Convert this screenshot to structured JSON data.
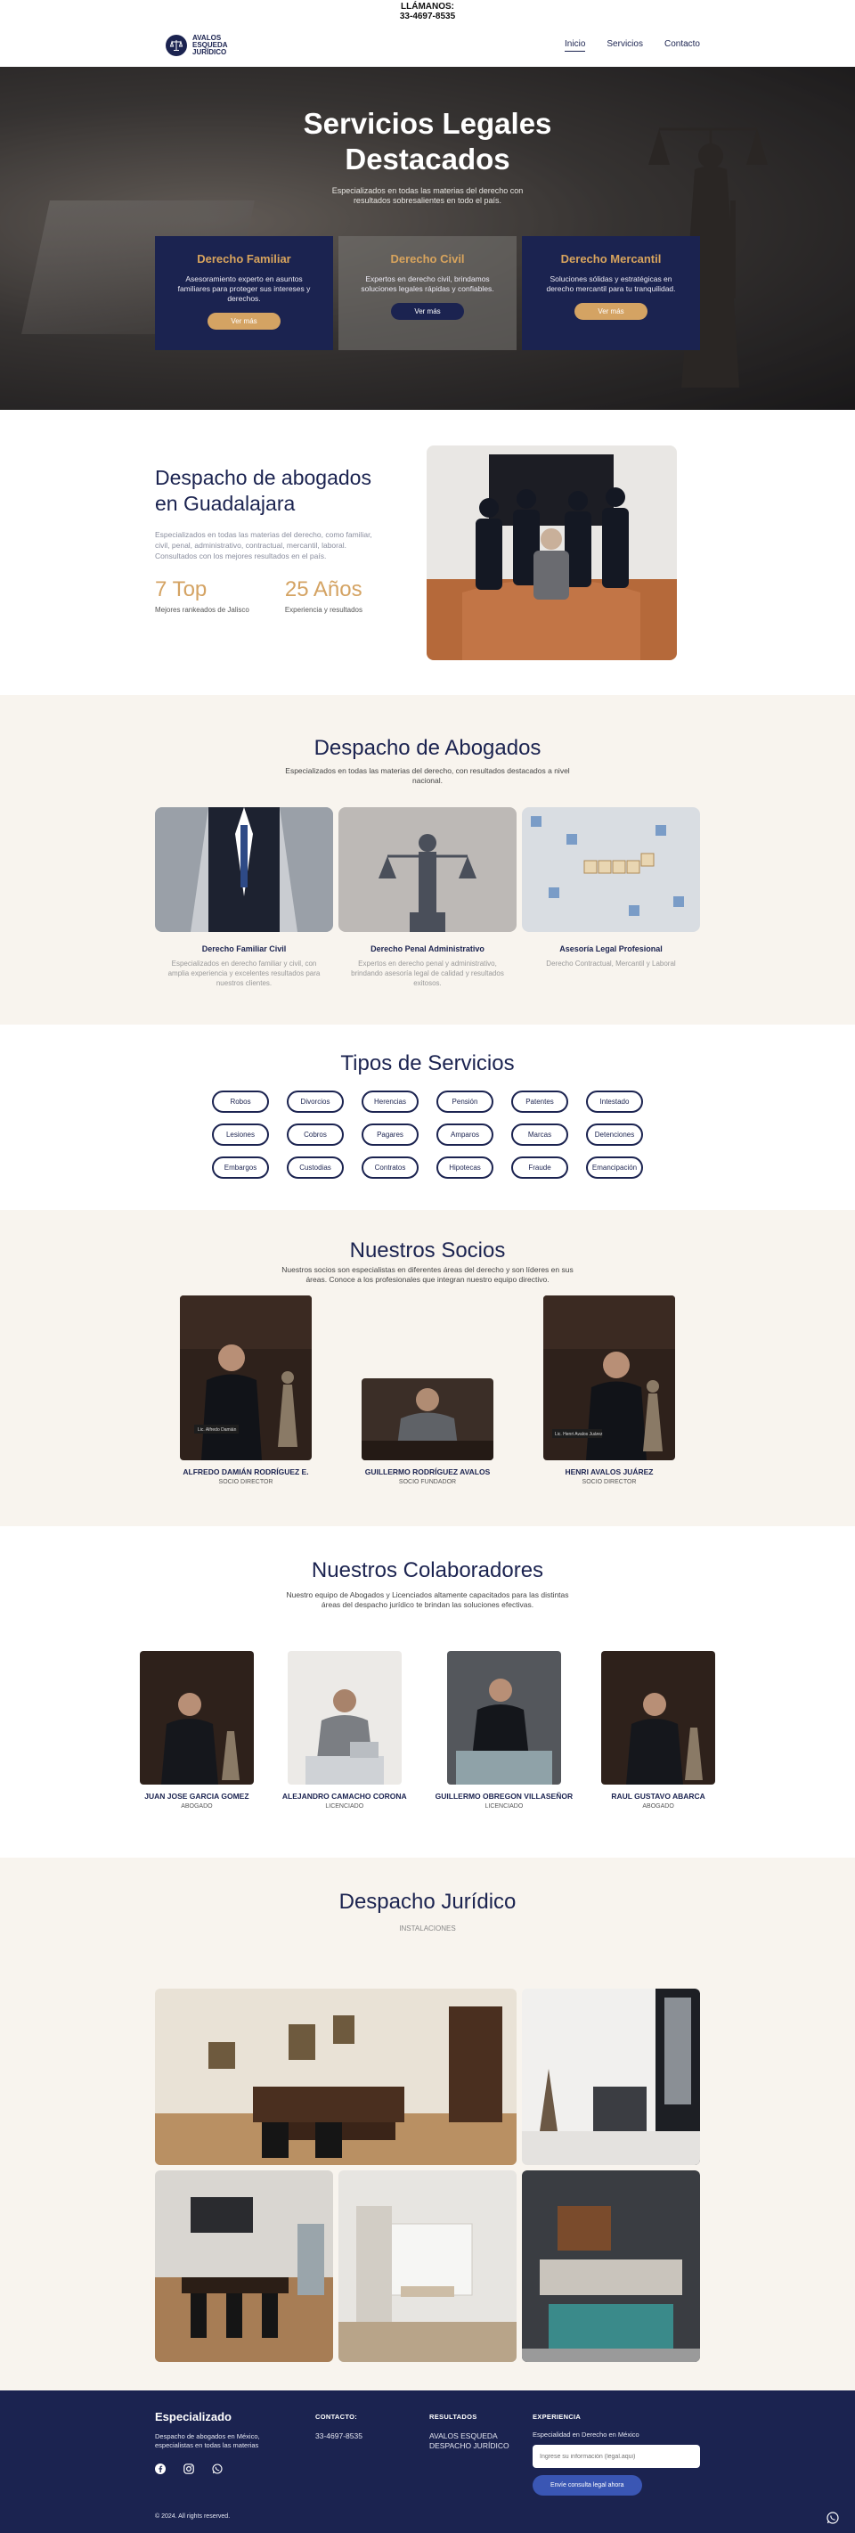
{
  "topbar": {
    "label": "LLÁMANOS:",
    "phone": "33-4697-8535"
  },
  "brand": {
    "line1": "AVALOS",
    "line2": "ESQUEDA",
    "line3": "JURÍDICO"
  },
  "nav": {
    "items": [
      "Inicio",
      "Servicios",
      "Contacto"
    ]
  },
  "hero": {
    "title": "Servicios Legales Destacados",
    "subtitle": "Especializados en todas las materias del derecho con resultados sobresalientes en todo el país.",
    "cards": [
      {
        "title": "Derecho Familiar",
        "text": "Asesoramiento experto en asuntos familiares para proteger sus intereses y derechos.",
        "button": "Ver más"
      },
      {
        "title": "Derecho Civil",
        "text": "Expertos en derecho civil, brindamos soluciones legales rápidas y confiables.",
        "button": "Ver más"
      },
      {
        "title": "Derecho Mercantil",
        "text": "Soluciones sólidas y estratégicas en derecho mercantil para tu tranquilidad.",
        "button": "Ver más"
      }
    ]
  },
  "about": {
    "title": "Despacho de abogados en Guadalajara",
    "text": "Especializados en todas las materias del derecho, como familiar, civil, penal, administrativo, contractual, mercantil, laboral. Consultados con los mejores resultados en el país.",
    "stats": [
      {
        "value": "7 Top",
        "label": "Mejores rankeados de Jalisco"
      },
      {
        "value": "25 Años",
        "label": "Experiencia y resultados"
      }
    ]
  },
  "despacho": {
    "title": "Despacho de Abogados",
    "subtitle": "Especializados en todas las materias del derecho, con resultados destacados a nivel nacional.",
    "cards": [
      {
        "title": "Derecho Familiar Civil",
        "text": "Especializados en derecho familiar y civil, con amplia experiencia y excelentes resultados para nuestros clientes."
      },
      {
        "title": "Derecho Penal Administrativo",
        "text": "Expertos en derecho penal y administrativo, brindando asesoría legal de calidad y resultados exitosos."
      },
      {
        "title": "Asesoría Legal Profesional",
        "text": "Derecho Contractual, Mercantil y Laboral"
      }
    ]
  },
  "tipos": {
    "title": "Tipos de Servicios",
    "chips": [
      "Robos",
      "Divorcios",
      "Herencias",
      "Pensión",
      "Patentes",
      "Intestado",
      "Lesiones",
      "Cobros",
      "Pagares",
      "Amparos",
      "Marcas",
      "Detenciones",
      "Embargos",
      "Custodias",
      "Contratos",
      "Hipotecas",
      "Fraude",
      "Emancipación"
    ]
  },
  "socios": {
    "title": "Nuestros Socios",
    "subtitle": "Nuestros socios son especialistas en diferentes áreas del derecho y son líderes en sus áreas. Conoce a los profesionales que integran nuestro equipo directivo.",
    "people": [
      {
        "name": "ALFREDO DAMIÁN RODRÍGUEZ E.",
        "role": "SOCIO DIRECTOR",
        "plaque": "Lic. Alfredo Damián"
      },
      {
        "name": "GUILLERMO RODRÍGUEZ AVALOS",
        "role": "SOCIO FUNDADOR"
      },
      {
        "name": "HENRI AVALOS JUÁREZ",
        "role": "SOCIO DIRECTOR",
        "plaque": "Lic. Henri Avalos Juárez"
      }
    ]
  },
  "colaboradores": {
    "title": "Nuestros Colaboradores",
    "subtitle": "Nuestro equipo de Abogados y Licenciados altamente capacitados para las distintas áreas del despacho jurídico te brindan las soluciones efectivas.",
    "people": [
      {
        "name": "JUAN JOSE GARCIA GOMEZ",
        "role": "ABOGADO"
      },
      {
        "name": "ALEJANDRO CAMACHO CORONA",
        "role": "LICENCIADO"
      },
      {
        "name": "GUILLERMO OBREGON VILLASEÑOR",
        "role": "LICENCIADO"
      },
      {
        "name": "RAUL GUSTAVO ABARCA",
        "role": "ABOGADO"
      }
    ]
  },
  "instalaciones": {
    "title": "Despacho Jurídico",
    "subtitle": "INSTALACIONES"
  },
  "footer": {
    "brand": "Especializado",
    "description": "Despacho de abogados en México, especialistas en todas las materias",
    "contact_heading": "CONTACTO:",
    "contact_phone": "33-4697-8535",
    "results_heading": "RESULTADOS",
    "results_text": "AVALOS ESQUEDA DESPACHO JURÍDICO",
    "exp_heading": "EXPERIENCIA",
    "exp_text": "Especialidad en Derecho en México",
    "input_placeholder": "Ingrese su información (legal.aqui)",
    "button": "Envíe consulta legal ahora",
    "copyright": "© 2024. All rights reserved."
  },
  "colors": {
    "navy": "#1b2350",
    "gold": "#d4a363",
    "beige": "#f8f4ee",
    "blue_button": "#3a56b4"
  },
  "icons": [
    "scales-logo-icon",
    "facebook-icon",
    "instagram-icon",
    "whatsapp-icon"
  ]
}
